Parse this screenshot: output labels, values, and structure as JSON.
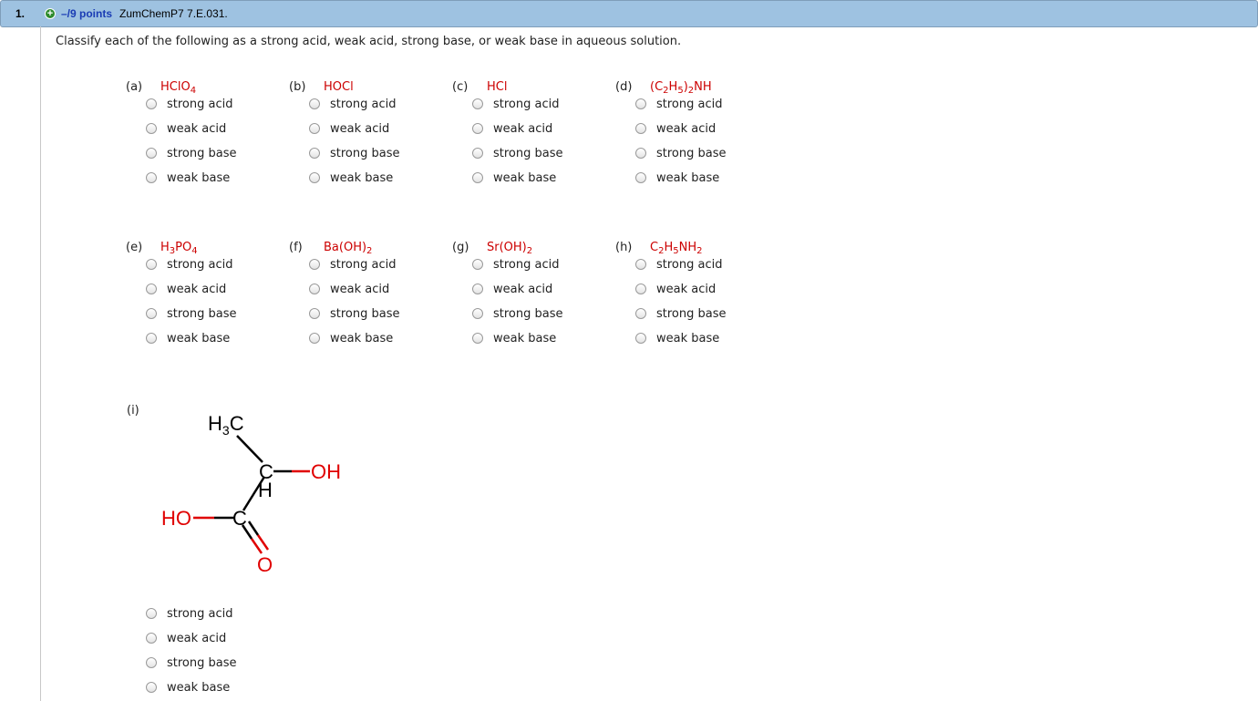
{
  "question": {
    "number": "1.",
    "points": "–/9 points",
    "code": "ZumChemP7 7.E.031.",
    "prompt": "Classify each of the following as a strong acid, weak acid, strong base, or weak base in aqueous solution."
  },
  "options": [
    "strong acid",
    "weak acid",
    "strong base",
    "weak base"
  ],
  "parts": [
    {
      "letter": "(a)",
      "formula": "HClO<sub>4</sub>"
    },
    {
      "letter": "(b)",
      "formula": "HOCl"
    },
    {
      "letter": "(c)",
      "formula": "HCl"
    },
    {
      "letter": "(d)",
      "formula": "(C<sub>2</sub>H<sub>5</sub>)<sub>2</sub>NH"
    },
    {
      "letter": "(e)",
      "formula": "H<sub>3</sub>PO<sub>4</sub>"
    },
    {
      "letter": "(f)",
      "formula": "Ba(OH)<sub>2</sub>"
    },
    {
      "letter": "(g)",
      "formula": "Sr(OH)<sub>2</sub>"
    },
    {
      "letter": "(h)",
      "formula": "C<sub>2</sub>H<sub>5</sub>NH<sub>2</sub>"
    }
  ],
  "part_i": {
    "letter": "(i)",
    "structure_atoms": {
      "h3c": "H",
      "h3c_sub": "3",
      "h3c_c": "C",
      "c1": "C",
      "oh1": "OH",
      "h": "H",
      "ho": "HO",
      "c2": "C",
      "o": "O"
    },
    "colors": {
      "bond": "#000000",
      "oxygen": "#e00000"
    }
  }
}
